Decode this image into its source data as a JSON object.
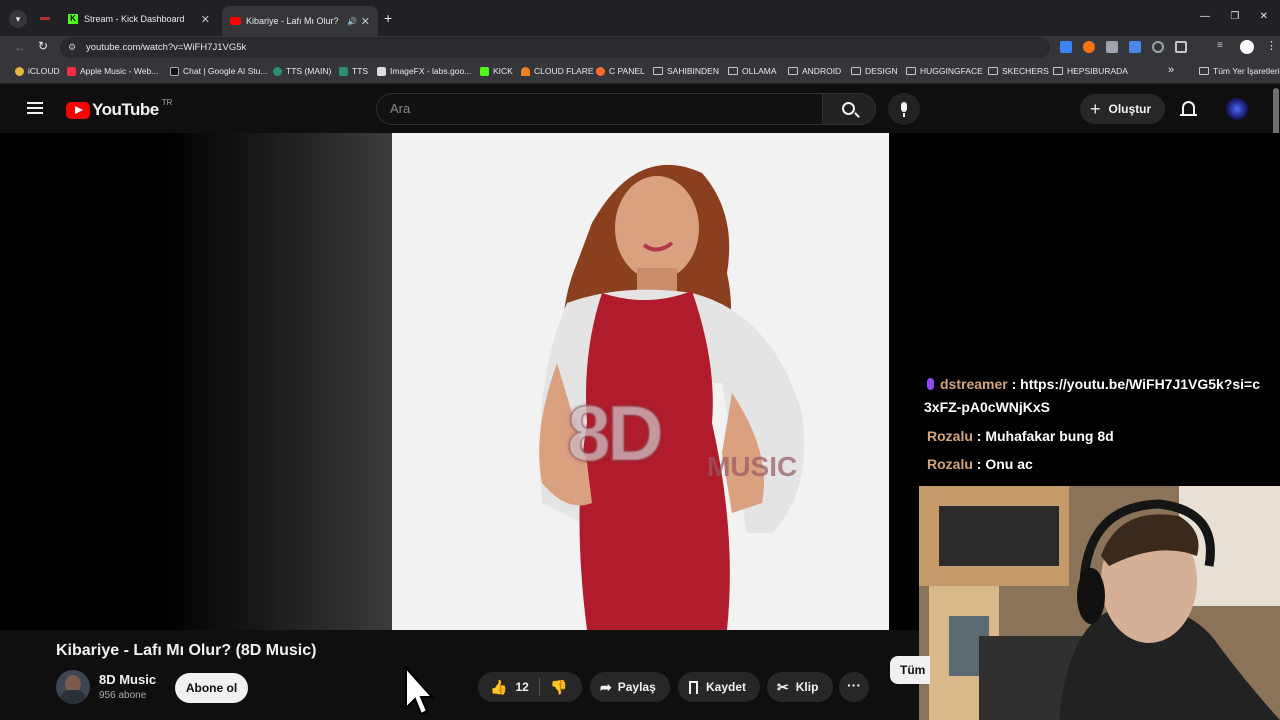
{
  "browser": {
    "tabs": [
      {
        "title": "Stream - Kick Dashboard",
        "close": "✕"
      },
      {
        "title": "Kibariye - Lafı Mı Olur? (8D",
        "close": "✕"
      }
    ],
    "new_tab": "+",
    "url": "youtube.com/watch?v=WiFH7J1VG5k",
    "bookmarks": [
      "iCLOUD",
      "Apple Music - Web...",
      "Chat | Google AI Stu...",
      "TTS (MAIN)",
      "TTS",
      "ImageFX - labs.goo...",
      "KICK",
      "CLOUD FLARE",
      "C PANEL",
      "SAHIBINDEN",
      "OLLAMA",
      "ANDROID",
      "DESIGN",
      "HUGGINGFACE",
      "SKECHERS",
      "HEPSIBURADA"
    ],
    "bookmarks_more": "»",
    "all_bookmarks": "Tüm Yer İşaretleri"
  },
  "youtube": {
    "logo_text": "YouTube",
    "region": "TR",
    "search_placeholder": "Ara",
    "create_label": "Oluştur",
    "video": {
      "watermark_main": "8D",
      "watermark_sub": "MUSIC"
    },
    "title": "Kibariye - Lafı Mı Olur? (8D Music)",
    "channel": {
      "name": "8D Music",
      "subscribers": "956 abone"
    },
    "subscribe_label": "Abone ol",
    "likes": "12",
    "share_label": "Paylaş",
    "save_label": "Kaydet",
    "clip_label": "Klip",
    "more_label": "···",
    "filter_label": "Tüm"
  },
  "chat": [
    {
      "name": "dstreamer",
      "sep": " : ",
      "message": "https://youtu.be/WiFH7J1VG5k?si=c3xFZ-pA0cWNjKxS"
    },
    {
      "name": "Rozalu",
      "sep": " : ",
      "message": "Muhafakar bung 8d"
    },
    {
      "name": "Rozalu",
      "sep": " : ",
      "message": "Onu ac"
    }
  ],
  "colors": {
    "yt_red": "#ff0000",
    "chat_name": "#d4a37f",
    "dstreamer_badge": "#9147ff"
  }
}
